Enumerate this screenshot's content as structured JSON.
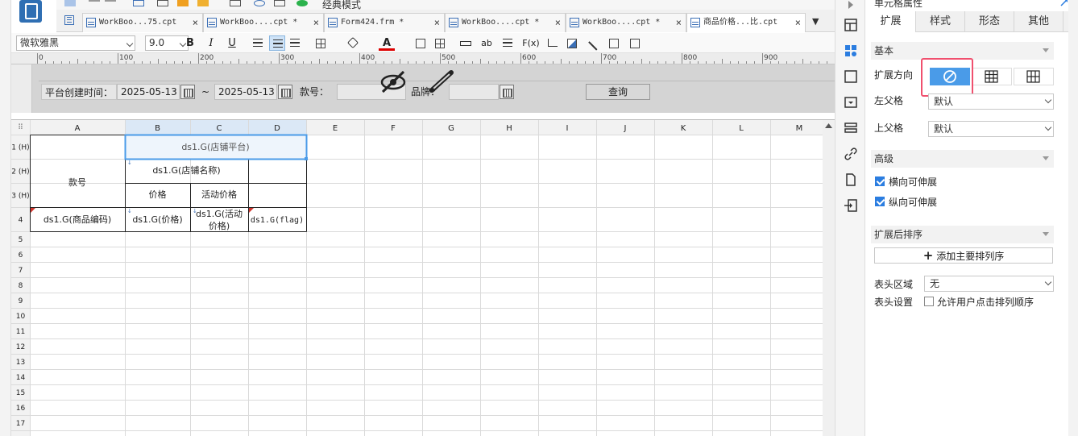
{
  "toolbar": {
    "classic_mode_label": "经典模式"
  },
  "tabs": [
    {
      "label": "WorkBoo...75.cpt",
      "close": "×"
    },
    {
      "label": "WorkBoo....cpt *",
      "close": "×"
    },
    {
      "label": "Form424.frm *",
      "close": "×"
    },
    {
      "label": "WorkBoo....cpt *",
      "close": "×"
    },
    {
      "label": "WorkBoo....cpt *",
      "close": "×"
    },
    {
      "label": "商品价格...比.cpt",
      "close": "×"
    }
  ],
  "format_bar": {
    "font": "微软雅黑",
    "size": "9.0",
    "bold": "B",
    "italic": "I",
    "underline": "U",
    "text_ab": "ab",
    "fx": "F(x)"
  },
  "ruler": {
    "marks": [
      "0",
      "100",
      "200",
      "300",
      "400",
      "500",
      "600",
      "700",
      "800",
      "900"
    ]
  },
  "param_panel": {
    "create_time_label": "平台创建时间：",
    "date_from": "2025-05-13",
    "tilde": "~",
    "date_to": "2025-05-13",
    "style_no_label": "款号：",
    "brand_label": "品牌：",
    "query_button": "查询"
  },
  "grid": {
    "columns": [
      "A",
      "B",
      "C",
      "D",
      "E",
      "F",
      "G",
      "H",
      "I",
      "J",
      "K",
      "L",
      "M"
    ],
    "rows": [
      "1 (H)",
      "2 (H)",
      "3 (H)",
      "4",
      "5",
      "6",
      "7",
      "8",
      "9",
      "10",
      "11",
      "12",
      "13",
      "14",
      "15",
      "16",
      "17"
    ],
    "cells": {
      "b1": "ds1.G(店铺平台)",
      "a2": "款号",
      "b2": "ds1.G(店铺名称)",
      "b3": "价格",
      "c3": "活动价格",
      "a4": "ds1.G(商品编码)",
      "b4": "ds1.G(价格)",
      "c4_line1": "ds1.G(活动",
      "c4_line2": "价格)",
      "d4": "ds1.G(flag)"
    }
  },
  "props": {
    "title": "单元格属性",
    "tabs": [
      "扩展",
      "样式",
      "形态",
      "其他"
    ],
    "basic_section": "基本",
    "expand_direction_label": "扩展方向",
    "left_parent_label": "左父格",
    "left_parent_value": "默认",
    "top_parent_label": "上父格",
    "top_parent_value": "默认",
    "advanced_section": "高级",
    "horizontal_expand": "横向可伸展",
    "vertical_expand": "纵向可伸展",
    "sort_section": "扩展后排序",
    "add_sort_button": "添加主要排列序",
    "header_area_label": "表头区域",
    "header_area_value": "无",
    "header_setting_label": "表头设置",
    "allow_user_sort": "允许用户点击排列顺序"
  },
  "colors": {
    "accent": "#2b7de0",
    "selection": "#4a9be8",
    "highlight_border": "#f0506e"
  }
}
